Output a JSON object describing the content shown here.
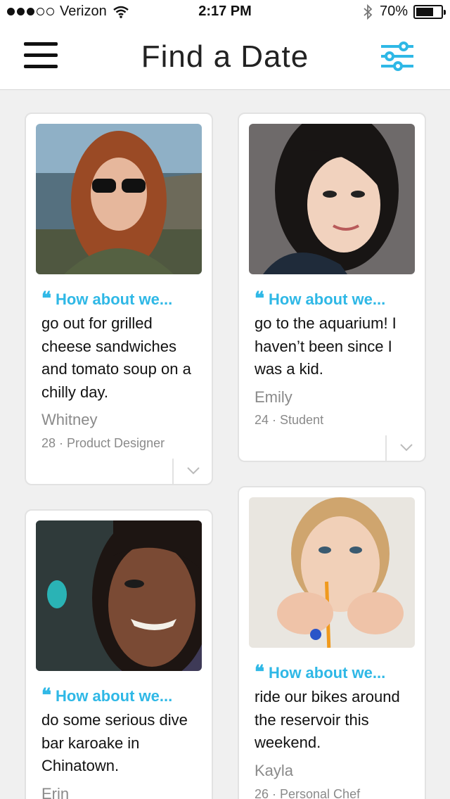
{
  "status": {
    "carrier": "Verizon",
    "time": "2:17 PM",
    "battery": "70%",
    "battery_level": 0.7
  },
  "nav": {
    "title": "Find a Date",
    "menu_icon": "hamburger-menu-icon",
    "filter_icon": "filter-sliders-icon"
  },
  "accent": "#2fb8e6",
  "cards": [
    {
      "prompt": "How about we...",
      "text": "go out for grilled cheese sandwiches and tomato soup on a chilly day.",
      "name": "Whitney",
      "meta": "28 · Product Designer"
    },
    {
      "prompt": "How about we...",
      "text": "go to the aquarium! I haven’t been since I was a kid.",
      "name": "Emily",
      "meta": "24 · Student"
    },
    {
      "prompt": "How about we...",
      "text": "do some serious dive bar karoake in Chinatown.",
      "name": "Erin",
      "meta": ""
    },
    {
      "prompt": "How about we...",
      "text": "ride our bikes around the reservoir this weekend.",
      "name": "Kayla",
      "meta": "26 · Personal Chef"
    }
  ]
}
